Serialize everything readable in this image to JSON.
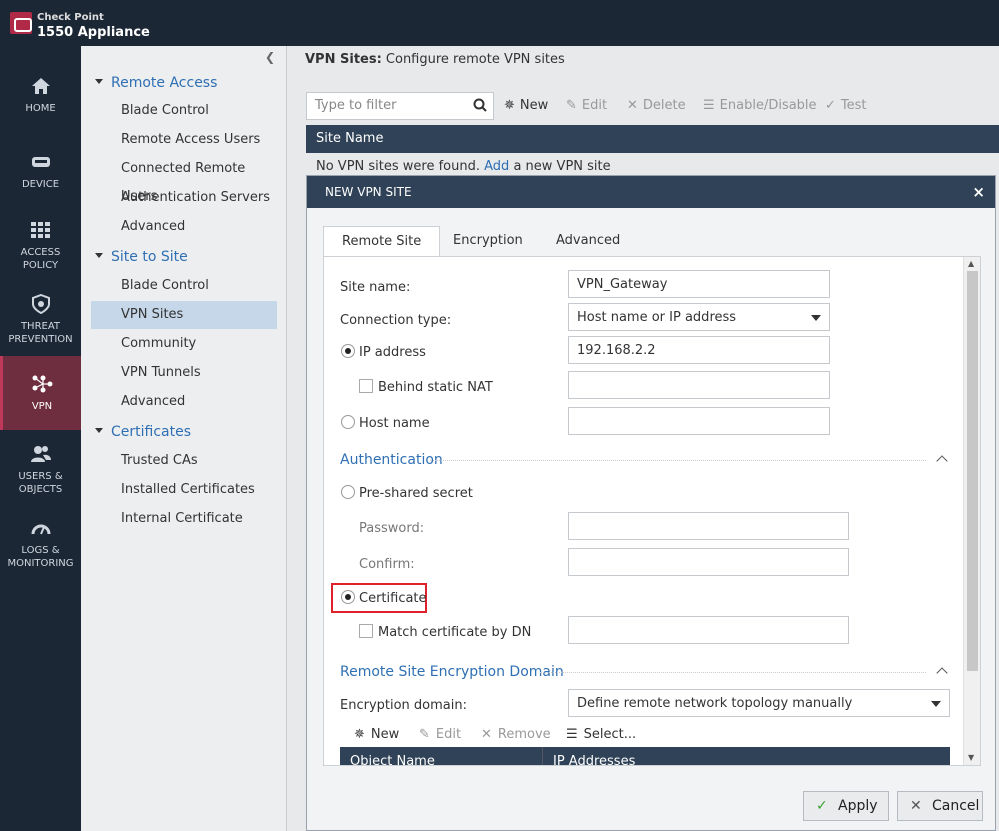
{
  "app": {
    "brand_line1": "Check Point",
    "brand_line2": "1550 Appliance"
  },
  "leftnav": [
    {
      "id": "home",
      "label1": "HOME",
      "label2": ""
    },
    {
      "id": "device",
      "label1": "DEVICE",
      "label2": ""
    },
    {
      "id": "access-policy",
      "label1": "ACCESS",
      "label2": "POLICY"
    },
    {
      "id": "threat-prevention",
      "label1": "THREAT",
      "label2": "PREVENTION"
    },
    {
      "id": "vpn",
      "label1": "VPN",
      "label2": ""
    },
    {
      "id": "users-objects",
      "label1": "USERS &",
      "label2": "OBJECTS"
    },
    {
      "id": "logs-monitoring",
      "label1": "LOGS &",
      "label2": "MONITORING"
    }
  ],
  "submenu": {
    "remote_access": {
      "title": "Remote Access",
      "items": [
        "Blade Control",
        "Remote Access Users",
        "Connected Remote Users",
        "Authentication Servers",
        "Advanced"
      ]
    },
    "site_to_site": {
      "title": "Site to Site",
      "items": [
        "Blade Control",
        "VPN Sites",
        "Community",
        "VPN Tunnels",
        "Advanced"
      ]
    },
    "certificates": {
      "title": "Certificates",
      "items": [
        "Trusted CAs",
        "Installed Certificates",
        "Internal Certificate"
      ]
    }
  },
  "main": {
    "title_bold": "VPN Sites:",
    "title_rest": " Configure remote VPN sites",
    "filter_placeholder": "Type to filter",
    "toolbar": {
      "new": "New",
      "edit": "Edit",
      "delete": "Delete",
      "enable_disable": "Enable/Disable",
      "test": "Test"
    },
    "table_header": "Site Name",
    "empty_text_1": "No VPN sites were found. ",
    "empty_link": "Add",
    "empty_text_2": " a new VPN site"
  },
  "dialog": {
    "title": "NEW VPN SITE",
    "close": "×",
    "tabs": [
      "Remote Site",
      "Encryption",
      "Advanced"
    ],
    "site_name_label": "Site name:",
    "site_name_value": "VPN_Gateway",
    "connection_type_label": "Connection type:",
    "connection_type_value": "Host name or IP address",
    "ip_address_label": "IP address",
    "ip_address_value": "192.168.2.2",
    "behind_nat_label": "Behind static NAT",
    "host_name_label": "Host name",
    "auth_section": "Authentication",
    "pre_shared_label": "Pre-shared secret",
    "password_label": "Password:",
    "confirm_label": "Confirm:",
    "certificate_label": "Certificate",
    "match_dn_label": "Match certificate by DN",
    "enc_domain_section": "Remote Site Encryption Domain",
    "enc_domain_label": "Encryption domain:",
    "enc_domain_value": "Define remote network topology manually",
    "mini_toolbar": {
      "new": "New",
      "edit": "Edit",
      "remove": "Remove",
      "select": "Select..."
    },
    "grid_cols": [
      "Object Name",
      "IP Addresses"
    ],
    "apply": "Apply",
    "cancel": "Cancel"
  }
}
